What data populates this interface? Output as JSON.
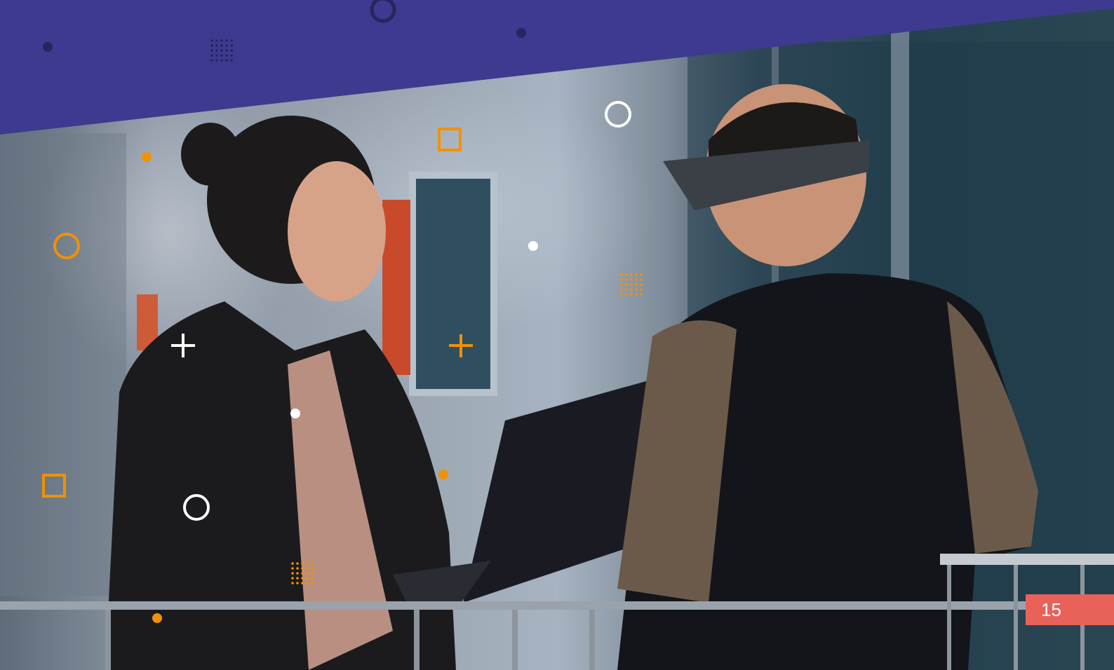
{
  "page": {
    "number": "15"
  },
  "photo": {
    "description_icon": "photo-people-with-vr-headset"
  },
  "colors": {
    "banner": "#3d3a8f",
    "accent_orange": "#f29104",
    "badge": "#e8625a",
    "white": "#ffffff",
    "dark_dot": "#27255e"
  }
}
